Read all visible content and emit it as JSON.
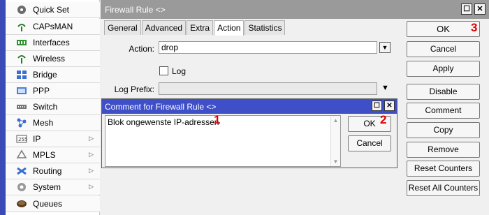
{
  "nav": {
    "items": [
      {
        "label": "Quick Set",
        "icon": "quickset-icon",
        "arrow": false
      },
      {
        "label": "CAPsMAN",
        "icon": "capsman-icon",
        "arrow": false
      },
      {
        "label": "Interfaces",
        "icon": "interfaces-icon",
        "arrow": false
      },
      {
        "label": "Wireless",
        "icon": "wireless-icon",
        "arrow": false
      },
      {
        "label": "Bridge",
        "icon": "bridge-icon",
        "arrow": false
      },
      {
        "label": "PPP",
        "icon": "ppp-icon",
        "arrow": false
      },
      {
        "label": "Switch",
        "icon": "switch-icon",
        "arrow": false
      },
      {
        "label": "Mesh",
        "icon": "mesh-icon",
        "arrow": false
      },
      {
        "label": "IP",
        "icon": "ip-icon",
        "arrow": true
      },
      {
        "label": "MPLS",
        "icon": "mpls-icon",
        "arrow": true
      },
      {
        "label": "Routing",
        "icon": "routing-icon",
        "arrow": true
      },
      {
        "label": "System",
        "icon": "system-icon",
        "arrow": true
      },
      {
        "label": "Queues",
        "icon": "queues-icon",
        "arrow": false
      }
    ],
    "arrow_glyph": "▷"
  },
  "window": {
    "title": "Firewall Rule <>",
    "restore_glyph": "☐",
    "close_glyph": "✕",
    "tabs": [
      "General",
      "Advanced",
      "Extra",
      "Action",
      "Statistics"
    ],
    "active_tab": "Action",
    "action_label": "Action:",
    "action_value": "drop",
    "log_label": "Log",
    "log_prefix_label": "Log Prefix:",
    "log_prefix_value": "",
    "dropdown_glyph": "▼"
  },
  "side_buttons": {
    "ok": "OK",
    "cancel": "Cancel",
    "apply": "Apply",
    "disable": "Disable",
    "comment": "Comment",
    "copy": "Copy",
    "remove": "Remove",
    "reset_counters": "Reset Counters",
    "reset_all_counters": "Reset All Counters"
  },
  "dialog": {
    "title": "Comment for Firewall Rule <>",
    "comment_text": "Blok ongewenste IP-adressen",
    "ok": "OK",
    "cancel": "Cancel",
    "scroll_up": "▲",
    "scroll_down": "▼"
  },
  "annotations": {
    "one": "1",
    "two": "2",
    "three": "3"
  },
  "colors": {
    "nav_strip": "#3a4bb8",
    "dialog_title": "#3f4fc7",
    "window_title": "#9a9a9a",
    "marker": "#e00000"
  }
}
